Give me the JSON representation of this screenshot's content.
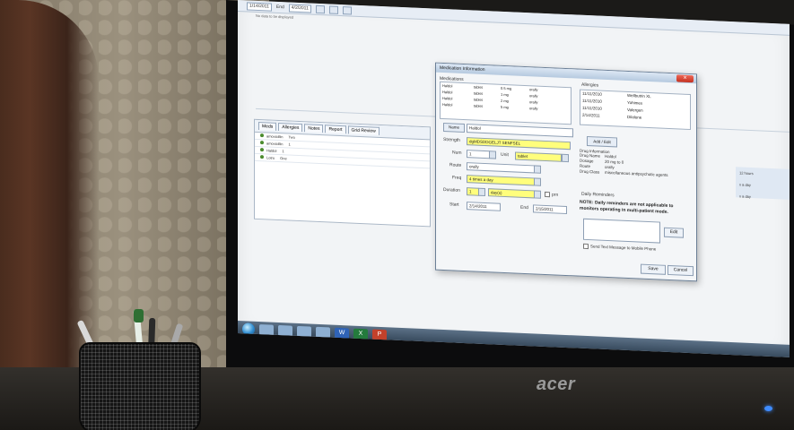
{
  "top_toolbar": {
    "date_from": "1/14/2011",
    "date_to": "4/2/2011",
    "end_label": "End"
  },
  "no_data": "No data to be displayed",
  "left_panel": {
    "tabs": [
      "Meds",
      "Allergies",
      "Notes",
      "Report",
      "Grid Review"
    ],
    "rows": [
      {
        "name": "amoxicillin",
        "value": "Two"
      },
      {
        "name": "amoxicillin",
        "value": "1"
      },
      {
        "name": "Haldol",
        "value": "1"
      },
      {
        "name": "Lotro",
        "value": "One"
      }
    ]
  },
  "right_strip": {
    "line1": "12 hours",
    "line2": "x a day",
    "line3": "x a day"
  },
  "dialog": {
    "title": "Medication Information",
    "medications_label": "Medications",
    "medications": [
      {
        "name": "Haldol",
        "form": "tablet",
        "dose": "0.5 mg",
        "route": "orally"
      },
      {
        "name": "Haldol",
        "form": "tablet",
        "dose": "1 mg",
        "route": "orally"
      },
      {
        "name": "Haldol",
        "form": "tablet",
        "dose": "2 mg",
        "route": "orally"
      },
      {
        "name": "Haldol",
        "form": "tablet",
        "dose": "5 mg",
        "route": "orally"
      }
    ],
    "allergies_label": "Allergies",
    "allergies": [
      {
        "date": "11/11/2010",
        "name": "Wellbutrin XL"
      },
      {
        "date": "11/11/2010",
        "name": "Yohimex"
      },
      {
        "date": "11/11/2010",
        "name": "Valergen"
      },
      {
        "date": "2/14/2011",
        "name": "Dilalone"
      }
    ],
    "name_button": "Name",
    "name_value": "Haldol",
    "strength_label": "Strength",
    "strength_value": "dgMDSDDGELJT SENFSEL",
    "num_label": "Num",
    "num_value": "1",
    "unit_label": "Unit",
    "unit_value": "tablet",
    "route_label": "Route",
    "route_value": "orally",
    "freq_label": "Freq",
    "freq_value": "4 times a day",
    "duration_label": "Duration",
    "duration_value": "1",
    "duration_unit": "day(s)",
    "prn_label": "prn",
    "start_label": "Start",
    "start_value": "2/14/2011",
    "end_label": "End",
    "end_value": "2/15/2011",
    "add_edit": "Add / Edit",
    "drug_info_label": "Drug Information",
    "drug_info": [
      {
        "label": "Drug Name",
        "value": "Haldol"
      },
      {
        "label": "Dosage",
        "value": "20 mg to 0"
      },
      {
        "label": "Route",
        "value": "orally"
      },
      {
        "label": "Drug Class",
        "value": "miscellaneous antipsychotic agents"
      }
    ],
    "daily_reminders_label": "Daily Reminders",
    "note": "NOTE: Daily reminders are not applicable to monitors operating in multi-patient mode.",
    "edit_label": "Edit",
    "send_text_label": "Send Text Message to Mobile Phone",
    "save_label": "Save",
    "cancel_label": "Cancel"
  },
  "taskbar": {
    "items": [
      "W",
      "X",
      "P"
    ]
  },
  "monitor_brand": "acer"
}
